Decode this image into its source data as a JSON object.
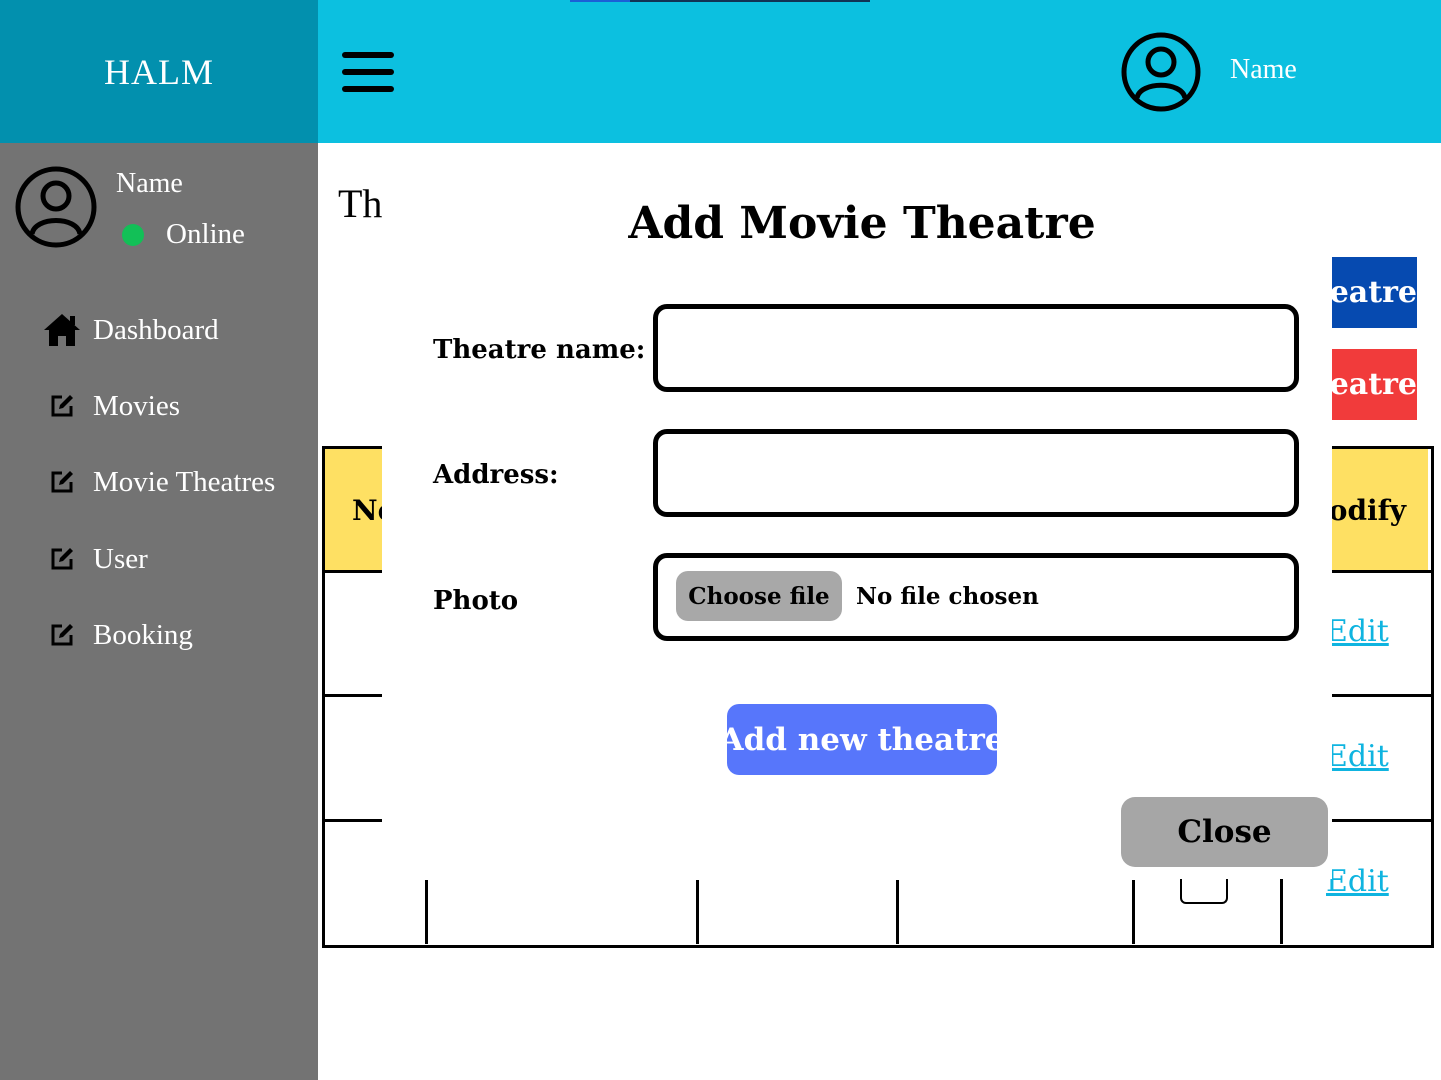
{
  "app": {
    "brand": "HALM"
  },
  "header": {
    "user_name": "Name"
  },
  "sidebar": {
    "user_name": "Name",
    "status": "Online",
    "items": [
      {
        "label": "Dashboard",
        "icon": "home-icon"
      },
      {
        "label": "Movies",
        "icon": "edit-icon"
      },
      {
        "label": "Movie Theatres",
        "icon": "edit-icon"
      },
      {
        "label": "User",
        "icon": "edit-icon"
      },
      {
        "label": "Booking",
        "icon": "edit-icon"
      }
    ]
  },
  "background_page": {
    "title_fragment": "Th",
    "blue_button_fragment": "eatre",
    "red_button_fragment": "eatre",
    "table_header_first_fragment": "No",
    "table_header_last_fragment": "Modify",
    "row_links": [
      "Edit",
      "Edit",
      "Edit"
    ]
  },
  "modal": {
    "title": "Add Movie Theatre",
    "fields": {
      "theatre_name_label": "Theatre name:",
      "theatre_name_value": "",
      "address_label": "Address:",
      "address_value": "",
      "photo_label": "Photo",
      "choose_file_label": "Choose file",
      "no_file_text": "No file chosen"
    },
    "submit_label": "Add new theatre",
    "close_label": "Close"
  },
  "colors": {
    "brand_bg": "#0290ae",
    "topbar_bg": "#0cc0e0",
    "sidebar_bg": "#737373",
    "online": "#12c057",
    "header_cell": "#fee063",
    "primary_button": "#5776fb",
    "close_button": "#a6a6a6",
    "danger_button": "#f13b3b",
    "blue_button": "#064ab0",
    "link": "#0fb4e0"
  }
}
